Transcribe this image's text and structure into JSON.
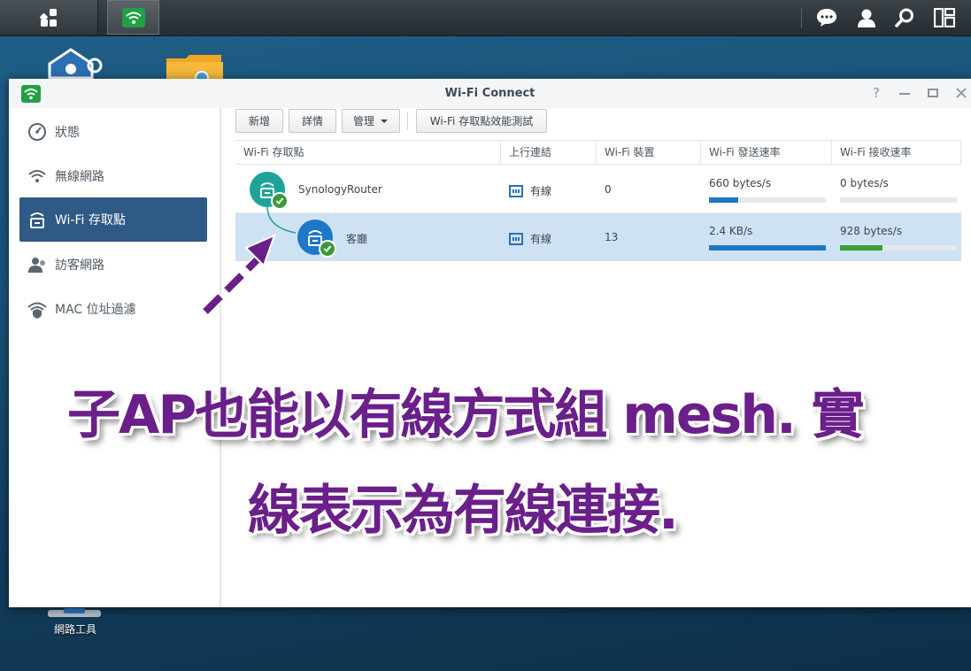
{
  "window": {
    "title": "Wi-Fi Connect"
  },
  "sidebar": {
    "items": [
      {
        "label": "狀態",
        "icon": "gauge-icon"
      },
      {
        "label": "無線網路",
        "icon": "wifi-icon"
      },
      {
        "label": "Wi-Fi 存取點",
        "icon": "router-icon",
        "active": true
      },
      {
        "label": "訪客網路",
        "icon": "guest-icon"
      },
      {
        "label": "MAC 位址過濾",
        "icon": "shield-wifi-icon"
      }
    ]
  },
  "toolbar": {
    "add": "新增",
    "details": "詳情",
    "manage": "管理",
    "speedtest": "Wi-Fi 存取點效能測試"
  },
  "table": {
    "headers": [
      "Wi-Fi 存取點",
      "上行連結",
      "Wi-Fi 裝置",
      "Wi-Fi 發送速率",
      "Wi-Fi 接收速率"
    ],
    "rows": [
      {
        "name": "SynologyRouter",
        "uplink": "有線",
        "devices": "0",
        "tx": "660 bytes/s",
        "rx": "0 bytes/s",
        "tx_level": 0.25,
        "rx_level": 0.0
      },
      {
        "name": "客廳",
        "uplink": "有線",
        "devices": "13",
        "tx": "2.4 KB/s",
        "rx": "928 bytes/s",
        "tx_level": 1.0,
        "rx_level": 0.36
      }
    ]
  },
  "desktop": {
    "network_tools_label": "網路工具"
  },
  "caption": {
    "line1": "子AP也能以有線方式組 mesh. 實",
    "line2": "線表示為有線連接."
  },
  "colors": {
    "accent_active": "#2f5a86",
    "ap_root": "#1ea39a",
    "ap_child": "#1e78c8",
    "bar_tx": "#1f78c8",
    "bar_rx": "#3f9e35",
    "caption": "#6a1f8a",
    "selected_row": "#cfe2f3"
  }
}
